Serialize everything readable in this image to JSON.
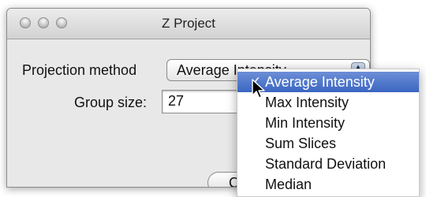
{
  "window": {
    "title": "Z Project"
  },
  "projection": {
    "label": "Projection method",
    "selected_value": "Average Intensity"
  },
  "group": {
    "label": "Group size:",
    "value": "27"
  },
  "buttons": {
    "cancel_label": "Ca"
  },
  "menu": {
    "check_glyph": "✓",
    "items": [
      "Average Intensity",
      "Max Intensity",
      "Min Intensity",
      "Sum Slices",
      "Standard Deviation",
      "Median"
    ]
  },
  "colors": {
    "selection": "#3a66c2",
    "window_bg": "#e8e8e8"
  },
  "icons": {
    "window_controls": [
      "close-icon",
      "minimize-icon",
      "zoom-icon"
    ],
    "popup_arrows": "up-down-arrows-icon",
    "pointer": "mouse-pointer-icon"
  }
}
